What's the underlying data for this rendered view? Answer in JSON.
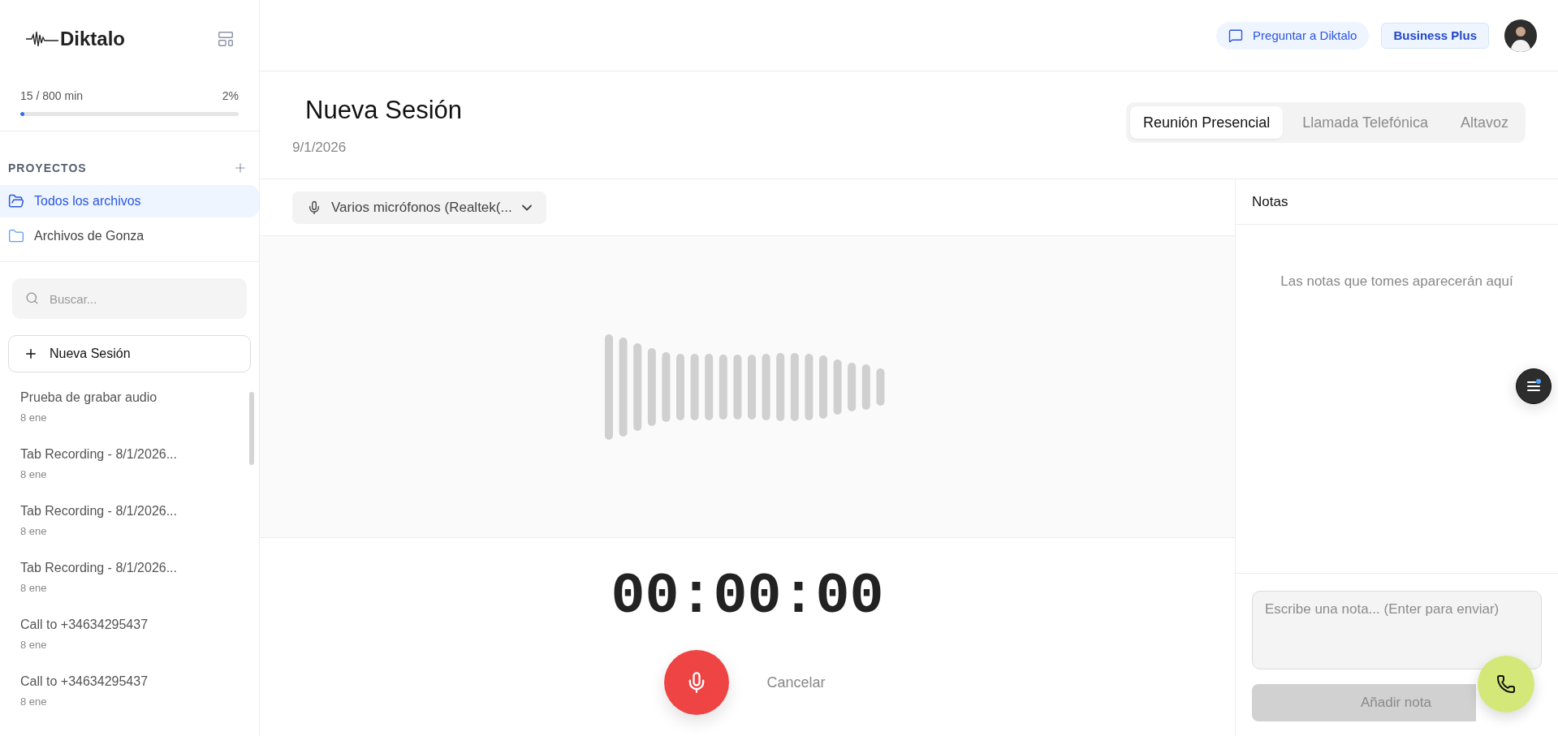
{
  "sidebar": {
    "logo": "Diktalo",
    "usage": {
      "text": "15 / 800 min",
      "percent": "2%",
      "level": 0.02
    },
    "projects_heading": "PROYECTOS",
    "projects": [
      {
        "label": "Todos los archivos",
        "selected": true
      },
      {
        "label": "Archivos de Gonza",
        "selected": false
      }
    ],
    "search": {
      "placeholder": "Buscar..."
    },
    "new_session": "Nueva Sesión",
    "sessions": [
      {
        "title": "Prueba de grabar audio",
        "date": "8 ene"
      },
      {
        "title": "Tab Recording - 8/1/2026...",
        "date": "8 ene"
      },
      {
        "title": "Tab Recording - 8/1/2026...",
        "date": "8 ene"
      },
      {
        "title": "Tab Recording - 8/1/2026...",
        "date": "8 ene"
      },
      {
        "title": "Call to +34634295437",
        "date": "8 ene"
      },
      {
        "title": "Call to +34634295437",
        "date": "8 ene"
      }
    ]
  },
  "header": {
    "ask_button": "Preguntar a Diktalo",
    "plan_badge": "Business Plus"
  },
  "session": {
    "title": "Nueva Sesión",
    "date": "9/1/2026",
    "modes": [
      {
        "label": "Reunión Presencial",
        "selected": true
      },
      {
        "label": "Llamada Telefónica",
        "selected": false
      },
      {
        "label": "Altavoz",
        "selected": false
      }
    ]
  },
  "microphone": {
    "value": "Varios micrófonos (Realtek(..."
  },
  "timer": "00:00:00",
  "cancel": "Cancelar",
  "notes": {
    "title": "Notas",
    "empty": "Las notas que tomes aparecerán aquí",
    "placeholder": "Escribe una nota... (Enter para enviar)",
    "add_button": {
      "label": "Añadir nota",
      "disabled": true
    }
  }
}
